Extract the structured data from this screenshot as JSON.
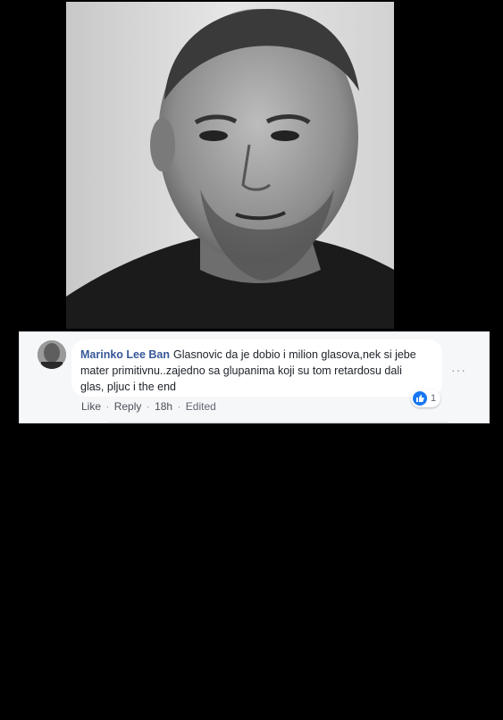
{
  "comment": {
    "author": "Marinko Lee Ban",
    "text_line1": "Glasnovic da je dobio i milion glasova,nek si jebe",
    "text_line2": "mater primitivnu..zajedno sa glupanima koji su tom retardosu dali",
    "text_line3": "glas, pljuc i the end",
    "reaction_count": "1",
    "actions": {
      "like": "Like",
      "reply": "Reply",
      "time": "18h",
      "edited": "Edited",
      "separator": "·"
    },
    "more_label": "···"
  },
  "icons": {
    "avatar": "avatar-photo",
    "reaction": "thumbs-up-icon",
    "more": "more-options-icon"
  },
  "colors": {
    "author": "#385898",
    "like_badge": "#1877f2",
    "background": "#000000"
  }
}
